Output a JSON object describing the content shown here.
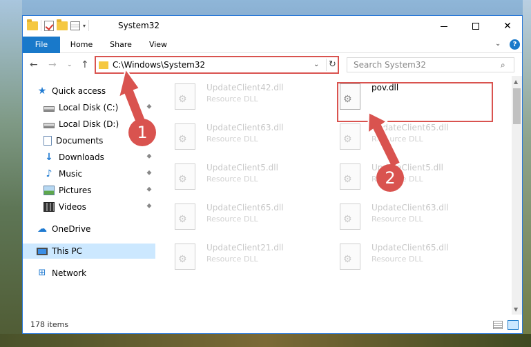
{
  "window": {
    "title": "System32",
    "minimize_label": "",
    "close_glyph": "✕"
  },
  "ribbon": {
    "tabs": [
      "File",
      "Home",
      "Share",
      "View"
    ],
    "expand_glyph": "⌄",
    "help_glyph": "?"
  },
  "navigation": {
    "back_glyph": "←",
    "forward_glyph": "→",
    "recent_glyph": "⌄",
    "up_glyph": "↑"
  },
  "address": {
    "path": "C:\\Windows\\System32",
    "dropdown_glyph": "⌄",
    "refresh_glyph": "↻"
  },
  "search": {
    "placeholder": "Search System32",
    "icon": "search-icon"
  },
  "sidebar": {
    "items": [
      {
        "label": "Quick access",
        "icon": "star-icon",
        "pinned": false
      },
      {
        "label": "Local Disk (C:)",
        "icon": "drive-icon",
        "pinned": true
      },
      {
        "label": "Local Disk (D:)",
        "icon": "drive-icon",
        "pinned": true
      },
      {
        "label": "Documents",
        "icon": "documents-icon",
        "pinned": true
      },
      {
        "label": "Downloads",
        "icon": "download-icon",
        "pinned": true
      },
      {
        "label": "Music",
        "icon": "music-icon",
        "pinned": true
      },
      {
        "label": "Pictures",
        "icon": "pictures-icon",
        "pinned": true
      },
      {
        "label": "Videos",
        "icon": "videos-icon",
        "pinned": true
      },
      {
        "label": "OneDrive",
        "icon": "cloud-icon",
        "pinned": false
      },
      {
        "label": "This PC",
        "icon": "computer-icon",
        "pinned": false,
        "selected": true
      },
      {
        "label": "Network",
        "icon": "network-icon",
        "pinned": false
      }
    ],
    "pin_glyph": "📌"
  },
  "files": [
    {
      "name": "UpdateClient42.dll",
      "type": "Resource DLL"
    },
    {
      "name": "pov.dll",
      "type": "",
      "highlighted": true
    },
    {
      "name": "UpdateClient63.dll",
      "type": "Resource DLL"
    },
    {
      "name": "UpdateClient65.dll",
      "type": "Resource DLL"
    },
    {
      "name": "UpdateClient5.dll",
      "type": "Resource DLL"
    },
    {
      "name": "UpdateClient5.dll",
      "type": "Resource DLL"
    },
    {
      "name": "UpdateClient65.dll",
      "type": "Resource DLL"
    },
    {
      "name": "UpdateClient63.dll",
      "type": "Resource DLL"
    },
    {
      "name": "UpdateClient21.dll",
      "type": "Resource DLL"
    },
    {
      "name": "UpdateClient65.dll",
      "type": "Resource DLL"
    }
  ],
  "status": {
    "item_count": "178 items"
  },
  "annotations": {
    "step1": "1",
    "step2": "2",
    "color": "#d9534f"
  }
}
